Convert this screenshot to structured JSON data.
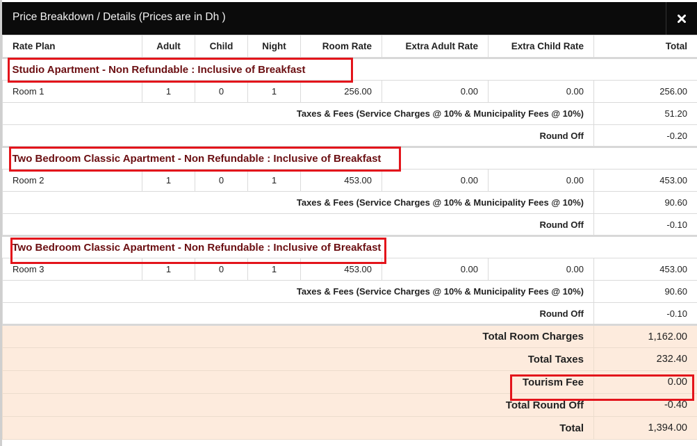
{
  "modal": {
    "title": "Price Breakdown / Details (Prices are in Dh )",
    "close_icon": "close-icon"
  },
  "columns": [
    "Rate Plan",
    "Adult",
    "Child",
    "Night",
    "Room Rate",
    "Extra Adult Rate",
    "Extra Child Rate",
    "Total"
  ],
  "rooms": [
    {
      "plan": "Studio Apartment - Non Refundable : Inclusive of Breakfast",
      "room": "Room 1",
      "adult": "1",
      "child": "0",
      "night": "1",
      "room_rate": "256.00",
      "extra_adult_rate": "0.00",
      "extra_child_rate": "0.00",
      "total": "256.00",
      "taxes_label": "Taxes & Fees (Service Charges @ 10% & Municipality Fees @ 10%)",
      "taxes_value": "51.20",
      "round_label": "Round Off",
      "round_value": "-0.20"
    },
    {
      "plan": "Two Bedroom Classic Apartment - Non Refundable : Inclusive of Breakfast",
      "room": "Room 2",
      "adult": "1",
      "child": "0",
      "night": "1",
      "room_rate": "453.00",
      "extra_adult_rate": "0.00",
      "extra_child_rate": "0.00",
      "total": "453.00",
      "taxes_label": "Taxes & Fees (Service Charges @ 10% & Municipality Fees @ 10%)",
      "taxes_value": "90.60",
      "round_label": "Round Off",
      "round_value": "-0.10"
    },
    {
      "plan": "Two Bedroom Classic Apartment - Non Refundable : Inclusive of Breakfast",
      "room": "Room 3",
      "adult": "1",
      "child": "0",
      "night": "1",
      "room_rate": "453.00",
      "extra_adult_rate": "0.00",
      "extra_child_rate": "0.00",
      "total": "453.00",
      "taxes_label": "Taxes & Fees (Service Charges @ 10% & Municipality Fees @ 10%)",
      "taxes_value": "90.60",
      "round_label": "Round Off",
      "round_value": "-0.10"
    }
  ],
  "summary": [
    {
      "label": "Total Room Charges",
      "value": "1,162.00"
    },
    {
      "label": "Total Taxes",
      "value": "232.40"
    },
    {
      "label": "Tourism Fee",
      "value": "0.00"
    },
    {
      "label": "Total Round Off",
      "value": "-0.40"
    },
    {
      "label": "Total",
      "value": "1,394.00"
    }
  ],
  "colors": {
    "header_bg": "#0b0b0b",
    "plan_text": "#6b0f12",
    "summary_bg": "#fdebdd",
    "highlight": "#e3141b"
  }
}
